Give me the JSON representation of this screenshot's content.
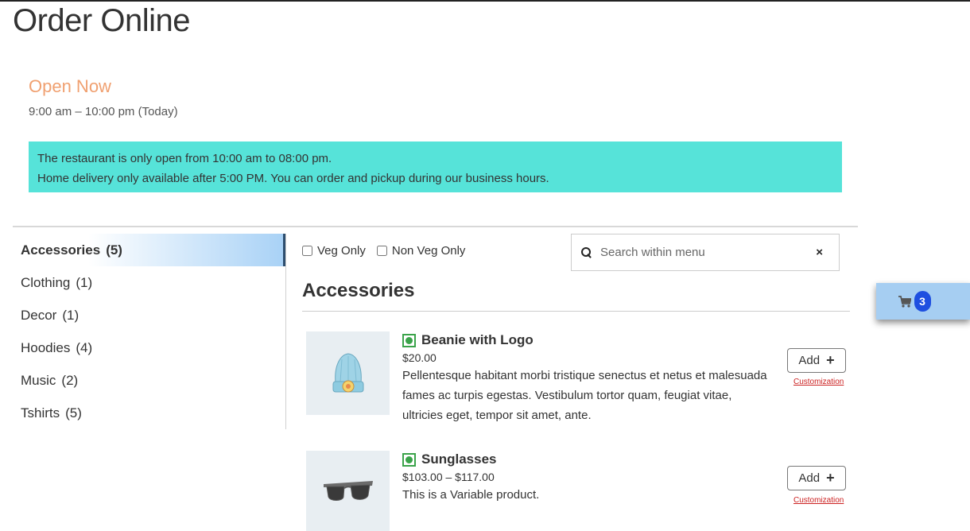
{
  "page": {
    "title": "Order Online",
    "status": "Open Now",
    "hours": "9:00 am – 10:00 pm (Today)"
  },
  "notice": {
    "line1": "The restaurant is only open from 10:00 am to 08:00 pm.",
    "line2": "Home delivery only available after 5:00 PM. You can order and pickup during our business hours."
  },
  "sidebar": {
    "categories": [
      {
        "label": "Accessories",
        "count": "(5)",
        "active": true
      },
      {
        "label": "Clothing",
        "count": "(1)"
      },
      {
        "label": "Decor",
        "count": "(1)"
      },
      {
        "label": "Hoodies",
        "count": "(4)"
      },
      {
        "label": "Music",
        "count": "(2)"
      },
      {
        "label": "Tshirts",
        "count": "(5)"
      }
    ]
  },
  "filters": {
    "veg_only": "Veg Only",
    "non_veg_only": "Non Veg Only"
  },
  "search": {
    "placeholder": "Search within menu",
    "clear": "×"
  },
  "section": {
    "title": "Accessories"
  },
  "products": [
    {
      "name": "Beanie with Logo",
      "price": "$20.00",
      "description": "Pellentesque habitant morbi tristique senectus et netus et malesuada fames ac turpis egestas. Vestibulum tortor quam, feugiat vitae, ultricies eget, tempor sit amet, ante.",
      "add_label": "Add",
      "plus": "+",
      "customization": "Customization"
    },
    {
      "name": "Sunglasses",
      "price": "$103.00 – $117.00",
      "description": "This is a Variable product.",
      "add_label": "Add",
      "plus": "+",
      "customization": "Customization"
    }
  ],
  "cart": {
    "count": "3"
  },
  "colors": {
    "accent_orange": "#f0a070",
    "notice_bg": "#56e3d9",
    "cart_bg": "#a6cef2",
    "badge": "#1e4fe0",
    "veg_green": "#3aa34a",
    "link_red": "#cc2222"
  },
  "icons": {
    "search": "search-icon",
    "clear": "close-icon",
    "cart": "cart-icon",
    "veg": "veg-indicator-icon"
  }
}
